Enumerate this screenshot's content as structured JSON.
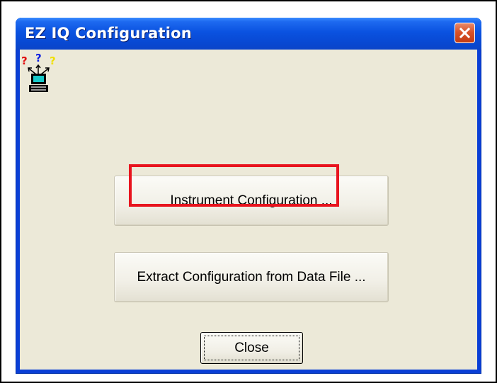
{
  "window": {
    "title": "EZ IQ Configuration",
    "close_glyph": "✕"
  },
  "buttons": {
    "instrument_configuration": "Instrument Configuration ...",
    "extract_configuration": "Extract Configuration from Data File ...",
    "close": "Close"
  },
  "icon": {
    "name": "instrument-config-icon",
    "question_marks": [
      "?",
      "?",
      "?"
    ],
    "question_colors": [
      "#e01010",
      "#0a1ee0",
      "#f0e000"
    ]
  },
  "annotation": {
    "highlight_color": "#e8141e"
  }
}
